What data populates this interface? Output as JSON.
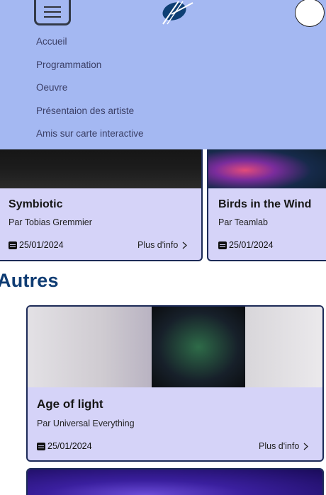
{
  "nav": {
    "items": [
      {
        "label": "Accueil"
      },
      {
        "label": "Programmation"
      },
      {
        "label": "Oeuvre"
      },
      {
        "label": "Présentaion des artiste"
      },
      {
        "label": "Amis sur carte interactive"
      }
    ]
  },
  "cards": [
    {
      "title": "Symbiotic",
      "artist": "Par Tobias Gremmier",
      "date": "25/01/2024",
      "more": "Plus d'info"
    },
    {
      "title": "Birds in the Wind",
      "artist": "Par Teamlab",
      "date": "25/01/2024"
    }
  ],
  "section": {
    "title": "Autres"
  },
  "others": [
    {
      "title": "Age of light",
      "artist": "Par Universal Everything",
      "date": "25/01/2024",
      "more": "Plus d'info"
    }
  ],
  "colors": {
    "header_bg": "#a4b8f2",
    "card_bg": "#d5d3f8",
    "card_border": "#1c2a57",
    "section_title": "#0f3c73"
  }
}
